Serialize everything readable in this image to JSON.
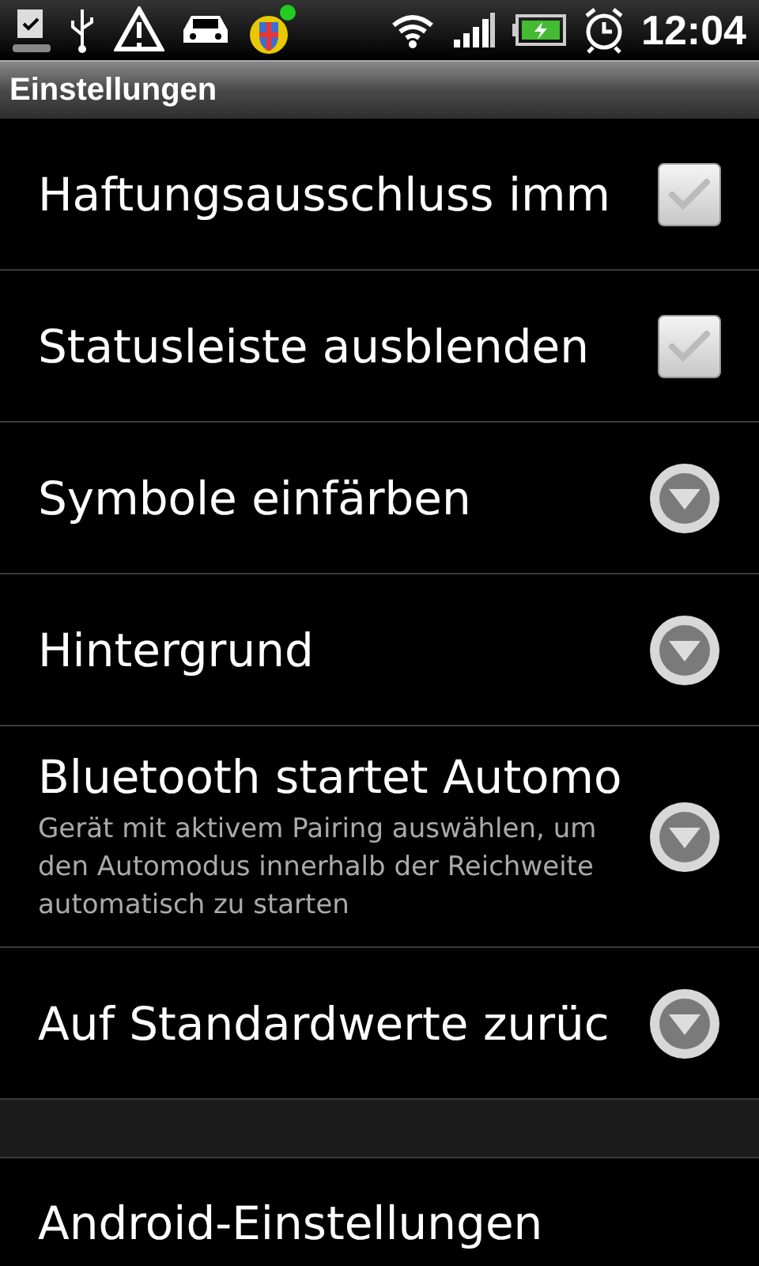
{
  "status_bar": {
    "time": "12:04"
  },
  "title": "Einstellungen",
  "items": [
    {
      "kind": "checkbox",
      "title": "Haftungsausschluss imm",
      "checked": true
    },
    {
      "kind": "checkbox",
      "title": "Statusleiste ausblenden",
      "checked": true
    },
    {
      "kind": "dropdown",
      "title": "Symbole einfärben"
    },
    {
      "kind": "dropdown",
      "title": "Hintergrund"
    },
    {
      "kind": "dropdown",
      "title": "Bluetooth startet Automo",
      "summary": "Gerät mit aktivem Pairing auswählen, um den Automodus innerhalb der Reichweite automatisch zu starten"
    },
    {
      "kind": "dropdown",
      "title": "Auf Standardwerte zurüc"
    },
    {
      "kind": "spacer"
    },
    {
      "kind": "plain",
      "title": "Android-Einstellungen"
    }
  ]
}
